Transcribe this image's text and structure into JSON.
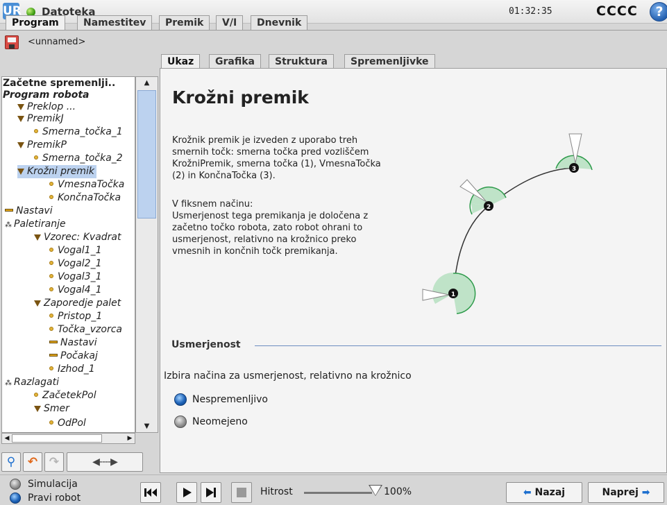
{
  "titlebar": {
    "logo": "UR",
    "file_menu": "Datoteka",
    "clock": "01:32:35",
    "robot_name": "CCCC",
    "help_icon": "?"
  },
  "top_tabs": [
    "Program",
    "Namestitev",
    "Premik",
    "V/I",
    "Dnevnik"
  ],
  "program_name": "<unnamed>",
  "tree": [
    "Začetne spremenlji..",
    "Program robota",
    "Preklop ...",
    "PremikJ",
    "Smerna_točka_1",
    "PremikP",
    "Smerna_točka_2",
    "Krožni premik",
    "VmesnaTočka",
    "KončnaTočka",
    "Nastavi",
    "Paletiranje",
    "Vzorec: Kvadrat",
    "Vogal1_1",
    "Vogal2_1",
    "Vogal3_1",
    "Vogal4_1",
    "Zaporedje palet",
    "Pristop_1",
    "Točka_vzorca",
    "Nastavi",
    "Počakaj",
    "Izhod_1",
    "Razlagati",
    "ZačetekPol",
    "Smer",
    "OdPol"
  ],
  "sub_tabs": [
    "Ukaz",
    "Grafika",
    "Struktura",
    "Spremenljivke"
  ],
  "main": {
    "title": "Krožni premik",
    "para1": "Krožnik premik je izveden z uporabo treh\nsmernih točk: smerna točka pred vozliščem\nKrožniPremik, smerna točka (1), VmesnaTočka\n(2) in KončnaTočka (3).",
    "para2": "V fiksnem načinu:\nUsmerjenost tega premikanja je določena z\nzačetno točko robota, zato robot ohrani to\nusmerjenost, relativno na krožnico preko\nvmesnih in končnih točk premikanja.",
    "diagram_labels": [
      "1",
      "2",
      "3"
    ],
    "section": "Usmerjenost",
    "choice_desc": "Izbira načina za usmerjenost, relativno na krožnico",
    "options": [
      "Nespremenljivo",
      "Neomejeno"
    ],
    "selected_option": "Nespremenljivo"
  },
  "bottom": {
    "modes": [
      "Simulacija",
      "Pravi robot"
    ],
    "selected_mode": "Pravi robot",
    "speed_label": "Hitrost",
    "speed_value": "100%",
    "speed_fraction": 1.0,
    "back": "Nazaj",
    "next": "Naprej"
  },
  "colors": {
    "accent": "#1d6fcf",
    "selection": "#bcd2ef",
    "zone_fill": "#bfe3c8",
    "zone_stroke": "#2d9a4a"
  }
}
